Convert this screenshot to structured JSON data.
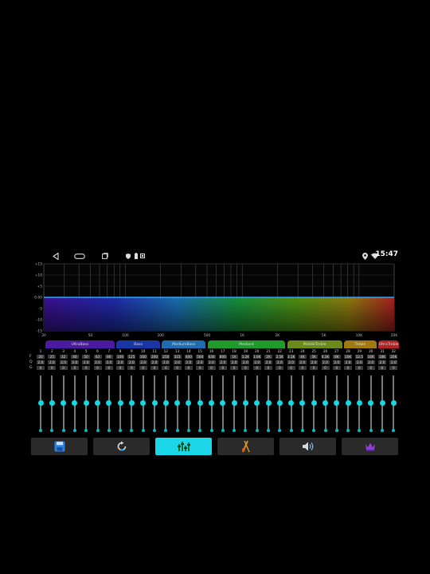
{
  "status_bar": {
    "time": "15:47",
    "icons": [
      "back-icon",
      "home-icon",
      "recents-icon",
      "shield-icon",
      "battery-icon",
      "stop-icon",
      "location-icon",
      "wifi-icon"
    ]
  },
  "spectrum": {
    "y_ticks": [
      "+15",
      "+10",
      "+5",
      "0.00",
      "-5",
      "-10",
      "-15"
    ],
    "x_ticks": [
      "20",
      "50",
      "100",
      "200",
      "500",
      "1K",
      "2K",
      "5K",
      "10K",
      "20K"
    ],
    "flat_level_db": 0
  },
  "bands": [
    {
      "label": "UltraBass",
      "color": "#4a1aa0"
    },
    {
      "label": "Bass",
      "color": "#1a35a6"
    },
    {
      "label": "MediumBass",
      "color": "#1f6db0"
    },
    {
      "label": "Mediant",
      "color": "#1f9a2b"
    },
    {
      "label": "MiddleTreble",
      "color": "#6a8a1a"
    },
    {
      "label": "Treble",
      "color": "#a07a10"
    },
    {
      "label": "UltraTreble",
      "color": "#b32323"
    }
  ],
  "row_labels": [
    "F",
    "Q",
    "G"
  ],
  "channels": [
    {
      "n": "1",
      "f": "20",
      "q": "2.0",
      "g": "0"
    },
    {
      "n": "2",
      "f": "25",
      "q": "2.0",
      "g": "0"
    },
    {
      "n": "3",
      "f": "32",
      "q": "2.0",
      "g": "0"
    },
    {
      "n": "4",
      "f": "40",
      "q": "2.0",
      "g": "0"
    },
    {
      "n": "5",
      "f": "50",
      "q": "2.0",
      "g": "0"
    },
    {
      "n": "6",
      "f": "63",
      "q": "2.0",
      "g": "0"
    },
    {
      "n": "7",
      "f": "80",
      "q": "2.0",
      "g": "0"
    },
    {
      "n": "8",
      "f": "100",
      "q": "2.0",
      "g": "0"
    },
    {
      "n": "9",
      "f": "125",
      "q": "2.0",
      "g": "0"
    },
    {
      "n": "10",
      "f": "160",
      "q": "2.0",
      "g": "0"
    },
    {
      "n": "11",
      "f": "200",
      "q": "2.0",
      "g": "0"
    },
    {
      "n": "12",
      "f": "250",
      "q": "2.0",
      "g": "0"
    },
    {
      "n": "13",
      "f": "315",
      "q": "2.0",
      "g": "0"
    },
    {
      "n": "14",
      "f": "400",
      "q": "2.0",
      "g": "0"
    },
    {
      "n": "15",
      "f": "500",
      "q": "2.0",
      "g": "0"
    },
    {
      "n": "16",
      "f": "630",
      "q": "2.0",
      "g": "0"
    },
    {
      "n": "17",
      "f": "800",
      "q": "2.0",
      "g": "0"
    },
    {
      "n": "18",
      "f": "1K",
      "q": "2.0",
      "g": "0"
    },
    {
      "n": "19",
      "f": "1.2K",
      "q": "2.0",
      "g": "0"
    },
    {
      "n": "20",
      "f": "1.6K",
      "q": "2.0",
      "g": "0"
    },
    {
      "n": "21",
      "f": "2K",
      "q": "2.0",
      "g": "0"
    },
    {
      "n": "22",
      "f": "2.5K",
      "q": "2.0",
      "g": "0"
    },
    {
      "n": "23",
      "f": "3.1K",
      "q": "2.0",
      "g": "0"
    },
    {
      "n": "24",
      "f": "4K",
      "q": "2.0",
      "g": "0"
    },
    {
      "n": "25",
      "f": "5K",
      "q": "2.0",
      "g": "0"
    },
    {
      "n": "26",
      "f": "6.3K",
      "q": "2.0",
      "g": "0"
    },
    {
      "n": "27",
      "f": "8K",
      "q": "2.0",
      "g": "0"
    },
    {
      "n": "28",
      "f": "10K",
      "q": "2.0",
      "g": "0"
    },
    {
      "n": "29",
      "f": "12.5",
      "q": "2.0",
      "g": "0"
    },
    {
      "n": "30",
      "f": "16K",
      "q": "2.0",
      "g": "0"
    },
    {
      "n": "31",
      "f": "18K",
      "q": "2.0",
      "g": "0"
    },
    {
      "n": "32",
      "f": "20K",
      "q": "2.0",
      "g": "0"
    }
  ],
  "slider_level_fraction": 0.5,
  "toolbar": [
    {
      "icon": "save-icon",
      "active": false
    },
    {
      "icon": "reset-icon",
      "active": false
    },
    {
      "icon": "equalizer-preset-icon",
      "active": true
    },
    {
      "icon": "music-style-icon",
      "active": false
    },
    {
      "icon": "volume-icon",
      "active": false
    },
    {
      "icon": "crown-icon",
      "active": false
    }
  ],
  "colors": {
    "accent": "#1ad6e6",
    "flat_line": "#2aa7ff"
  }
}
